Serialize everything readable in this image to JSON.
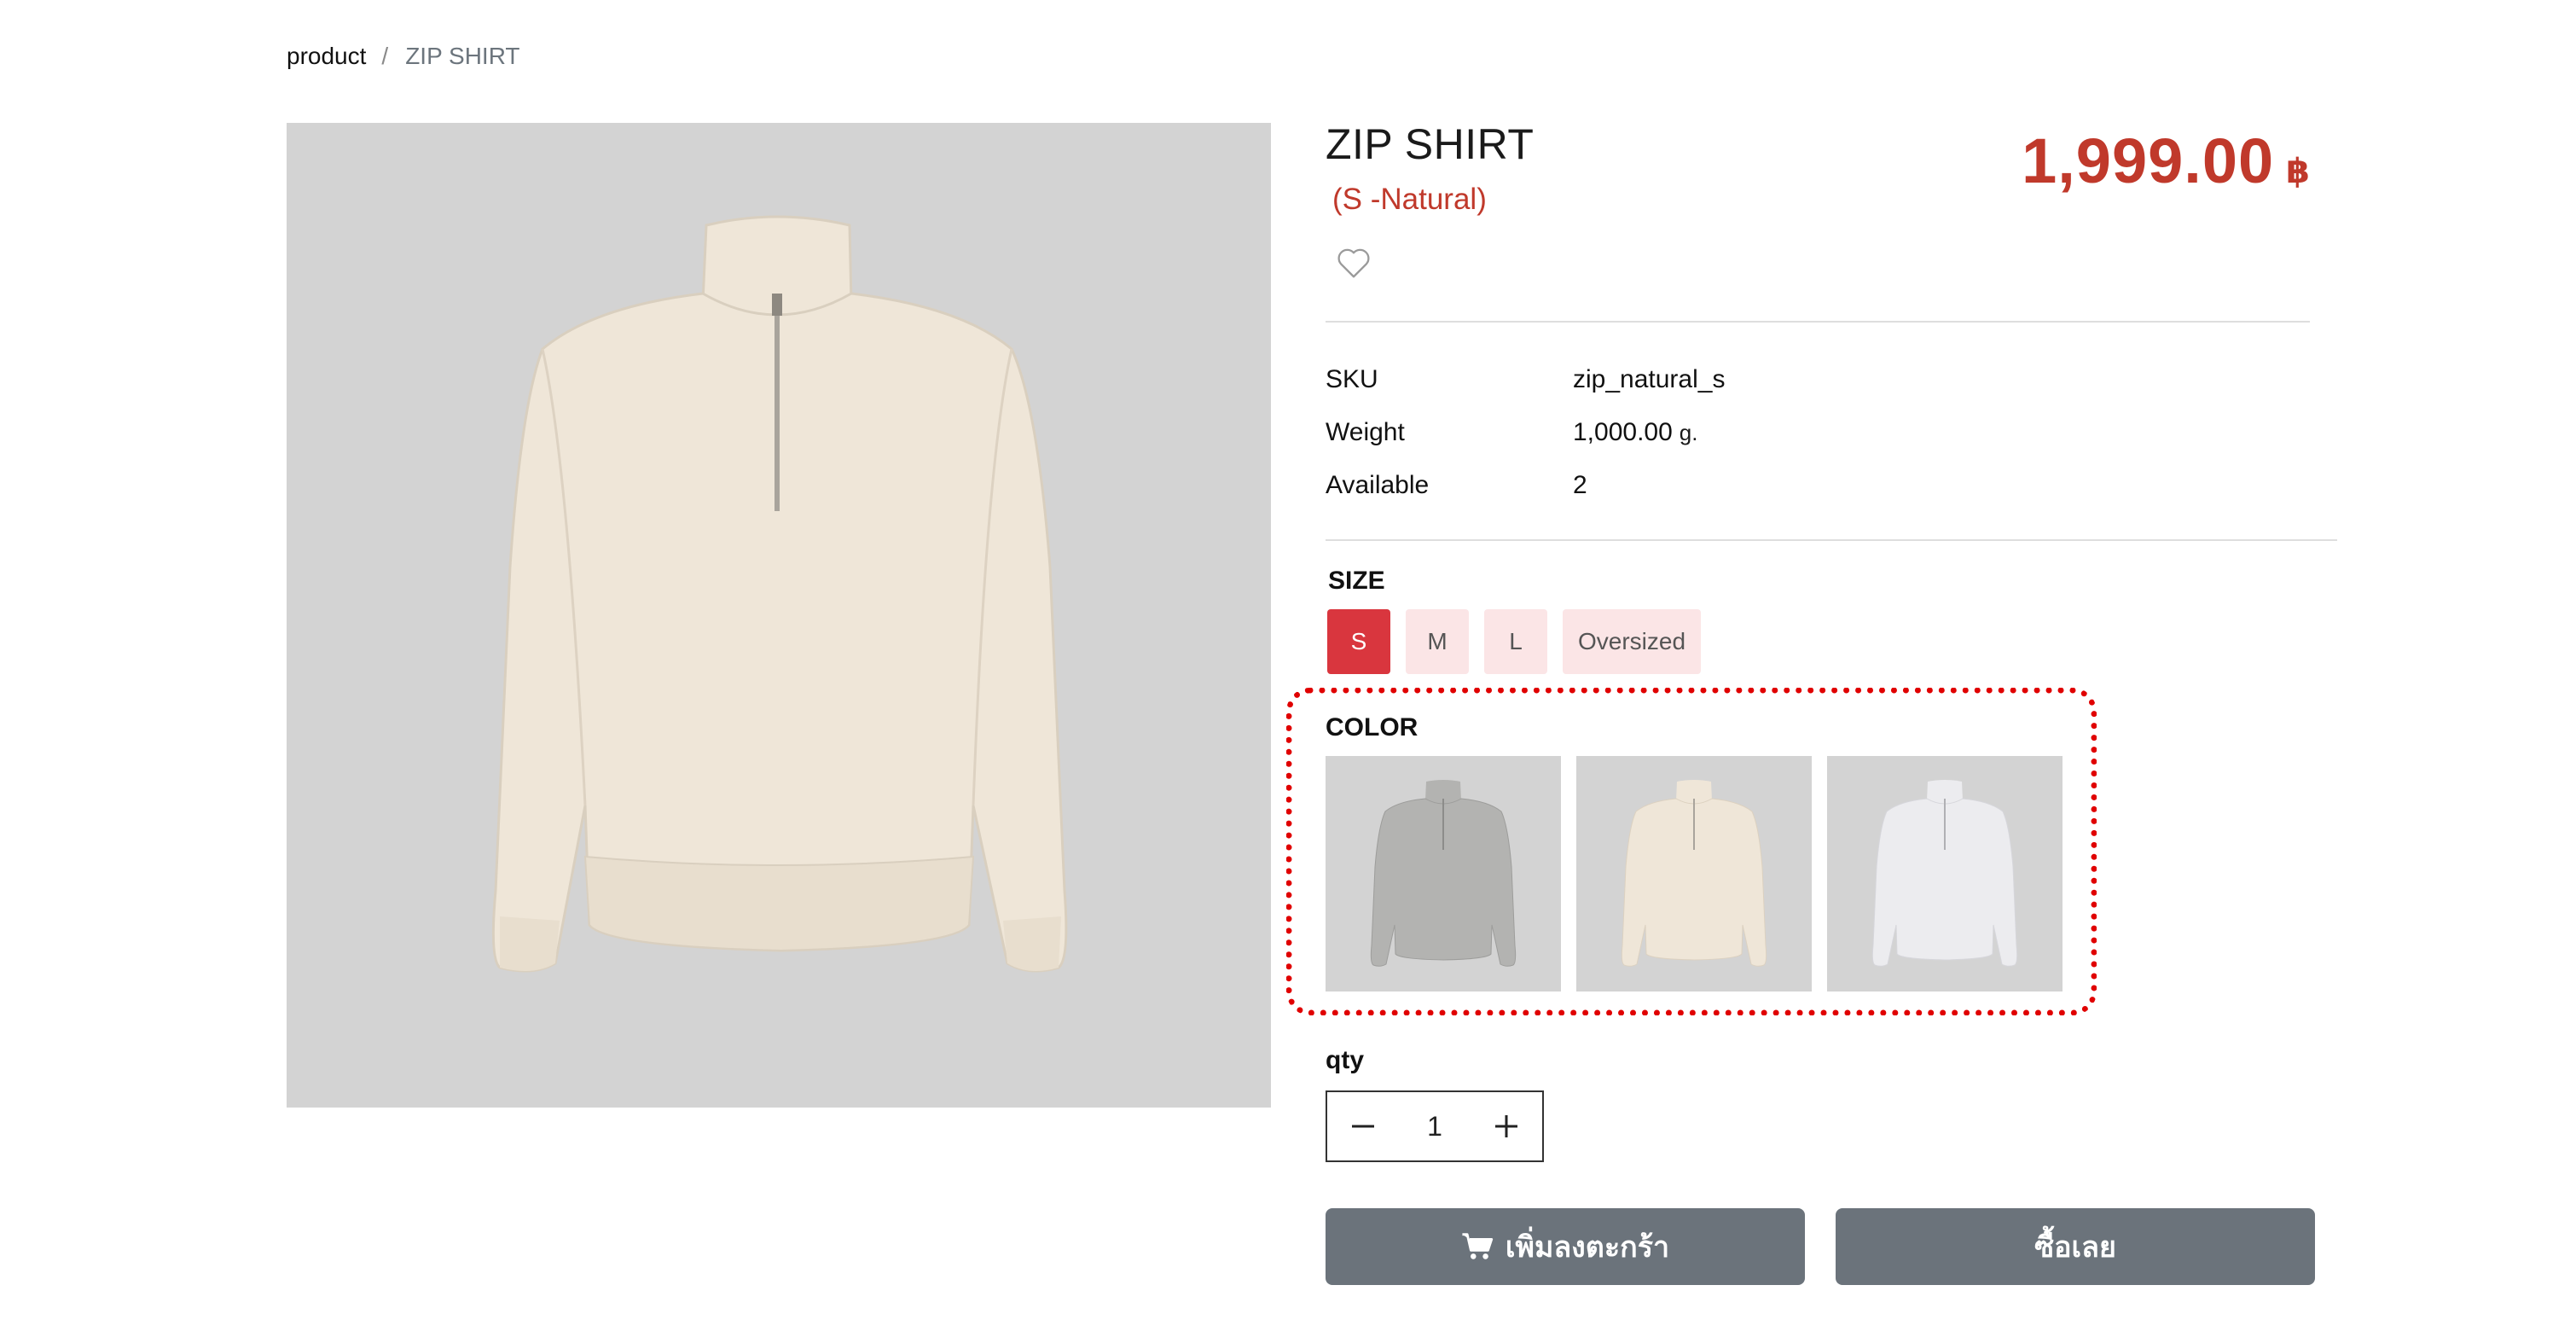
{
  "breadcrumb": {
    "root": "product",
    "separator": "/",
    "current": "ZIP SHIRT"
  },
  "product": {
    "title": "ZIP SHIRT",
    "variant": "(S -Natural)",
    "price": "1,999.00",
    "currency": "฿",
    "favorite_icon": "heart-outline-icon"
  },
  "specs": [
    {
      "label": "SKU",
      "value": "zip_natural_s",
      "unit": ""
    },
    {
      "label": "Weight",
      "value": "1,000.00",
      "unit": "g."
    },
    {
      "label": "Available",
      "value": "2",
      "unit": ""
    }
  ],
  "size": {
    "label": "SIZE",
    "options": [
      "S",
      "M",
      "L",
      "Oversized"
    ],
    "selected": "S"
  },
  "color": {
    "label": "COLOR",
    "swatches": [
      {
        "name": "Grey",
        "body": "#b3b3b1",
        "shade": "#9d9d9b"
      },
      {
        "name": "Natural",
        "body": "#ede4d6",
        "shade": "#dcd1c0"
      },
      {
        "name": "White",
        "body": "#ebebee",
        "shade": "#d6d6db"
      }
    ]
  },
  "qty": {
    "label": "qty",
    "value": "1"
  },
  "actions": {
    "add_to_cart": "เพิ่มลงตะกร้า",
    "add_to_cart_icon": "cart-icon",
    "buy_now": "ซื้อเลย"
  },
  "colors": {
    "accent_red": "#c0392b",
    "selected_size": "#d9363e",
    "size_bg": "#fbe5e6",
    "button_grey": "#6b737b",
    "image_bg": "#d3d3d3",
    "highlight": "#e00000"
  }
}
